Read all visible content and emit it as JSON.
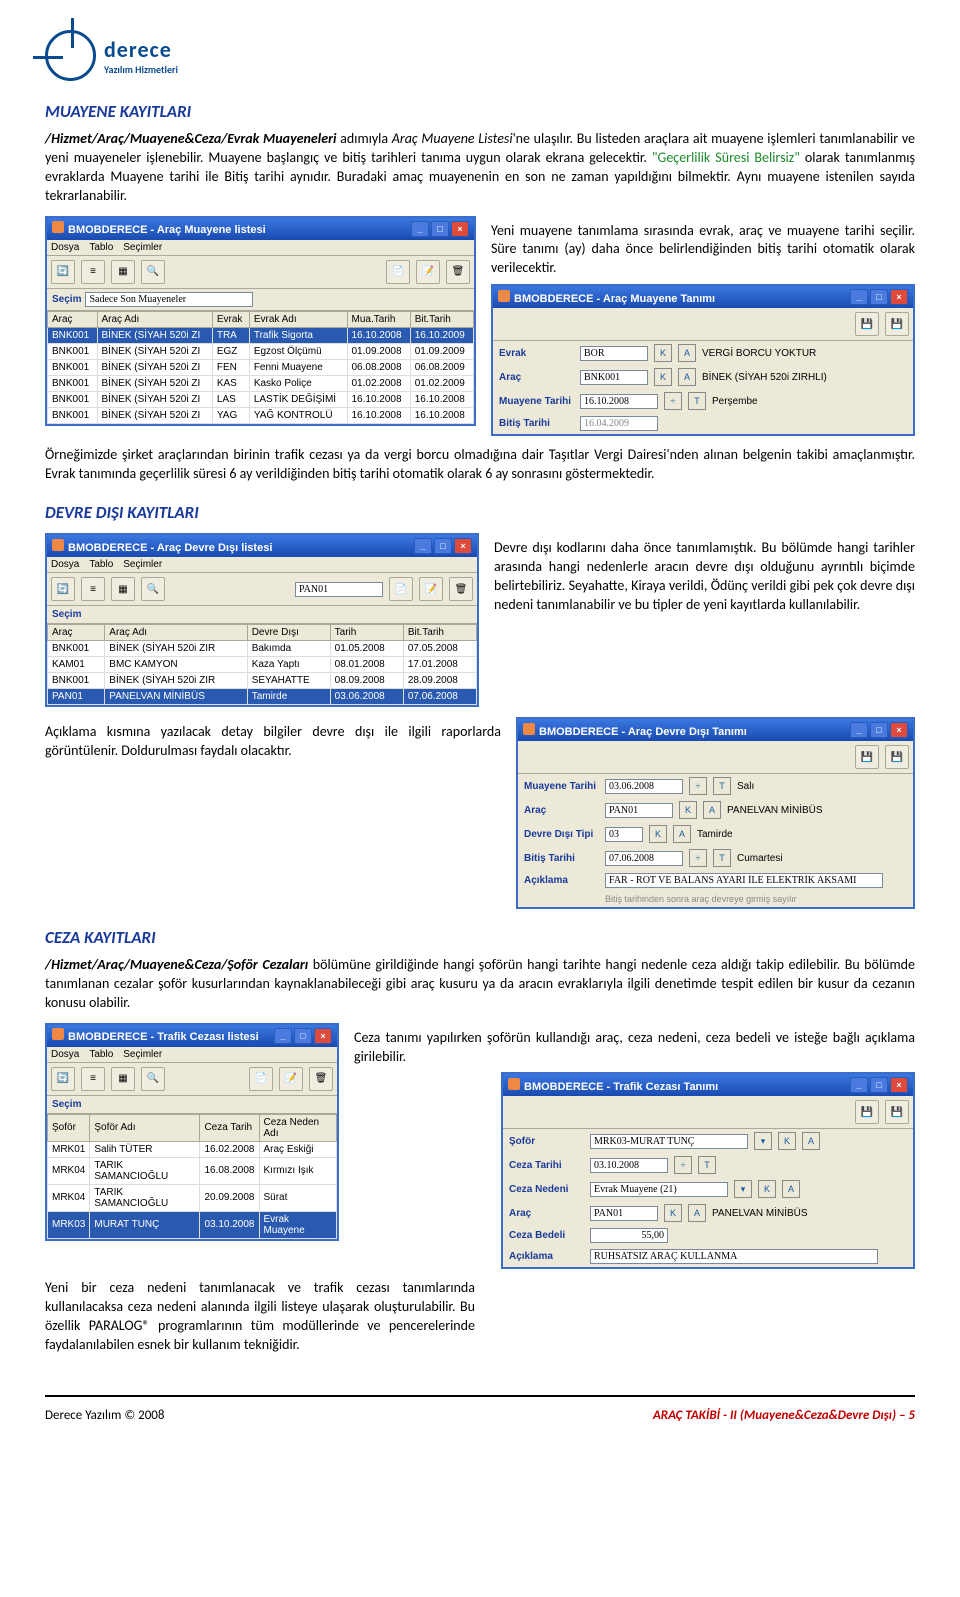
{
  "logo": {
    "t1": "derece",
    "t2": "Yazılım Hizmetleri"
  },
  "h1": "MUAYENE KAYITLARI",
  "p1a": "/Hizmet/Araç/Muayene&Ceza/Evrak Muayeneleri",
  "p1b": " adımıyla ",
  "p1c": "Araç Muayene Listesi",
  "p1d": "'ne ulaşılır. Bu listeden araçlara ait muayene işlemleri tanımlanabilir ve yeni muayeneler işlenebilir. Muayene başlangıç ve bitiş tarihleri tanıma uygun olarak ekrana gelecektir. ",
  "p1e": "\"Geçerlilik Süresi Belirsiz\"",
  "p1f": " olarak tanımlanmış evraklarda Muayene tarihi ile Bitiş tarihi aynıdır. Buradaki amaç muayenenin en son ne zaman yapıldığını bilmektir. Aynı muayene istenilen sayıda tekrarlanabilir.",
  "p2": "Yeni muayene tanımlama sırasında evrak, araç ve muayene tarihi seçilir. Süre tanımı (ay) daha önce belirlendiğinden bitiş tarihi otomatik olarak verilecektir.",
  "p3": "Örneğimizde şirket araçlarından birinin trafik cezası ya da vergi borcu olmadığına dair Taşıtlar Vergi Dairesi'nden alınan belgenin takibi amaçlanmıştır. Evrak tanımında geçerlilik süresi 6 ay verildiğinden bitiş tarihi otomatik olarak 6 ay sonrasını göstermektedir.",
  "h2": "DEVRE DIŞI KAYITLARI",
  "p4": "Devre dışı kodlarını daha önce tanımlamıştık. Bu bölümde hangi tarihler arasında hangi nedenlerle aracın devre dışı olduğunu ayrıntılı biçimde belirtebiliriz. Seyahatte, Kiraya verildi, Ödünç verildi gibi pek çok devre dışı nedeni tanımlanabilir ve bu tipler de yeni kayıtlarda kullanılabilir.",
  "p5": "Açıklama kısmına yazılacak detay bilgiler devre dışı ile ilgili raporlarda görüntülenir. Doldurulması faydalı olacaktır.",
  "h3": "CEZA KAYITLARI",
  "p6a": "/Hizmet/Araç/Muayene&Ceza/Şoför Cezaları",
  "p6b": " bölümüne girildiğinde hangi şoförün hangi tarihte hangi nedenle ceza aldığı takip edilebilir. Bu bölümde tanımlanan cezalar şoför kusurlarından kaynaklanabileceği gibi araç kusuru ya da aracın evraklarıyla ilgili denetimde tespit edilen bir kusur da cezanın konusu olabilir.",
  "p7": "Ceza tanımı yapılırken şoförün kullandığı araç, ceza nedeni, ceza bedeli ve isteğe bağlı açıklama girilebilir.",
  "p8": "Yeni bir ceza nedeni tanımlanacak ve trafik cezası tanımlarında kullanılacaksa ceza nedeni alanında ilgili listeye ulaşarak oluşturulabilir. Bu özellik PARALOG® programlarının tüm modüllerinde ve pencerelerinde faydalanılabilen esnek bir kullanım tekniğidir.",
  "footL": "Derece Yazılım © 2008",
  "footR": "ARAÇ TAKİBİ - II (Muayene&Ceza&Devre Dışı) – 5",
  "win1": {
    "title": "BMOBDERECE - Araç Muayene listesi",
    "menu": [
      "Dosya",
      "Tablo",
      "Seçimler"
    ],
    "secimLbl": "Seçim",
    "secimVal": "Sadece Son Muayeneler",
    "cols": [
      "Araç",
      "Araç Adı",
      "Evrak",
      "Evrak Adı",
      "Mua.Tarih",
      "Bit.Tarih"
    ],
    "rows": [
      [
        "BNK001",
        "BİNEK (SİYAH 520i ZI",
        "TRA",
        "Trafik Sigorta",
        "16.10.2008",
        "16.10.2009"
      ],
      [
        "BNK001",
        "BİNEK (SİYAH 520i ZI",
        "EGZ",
        "Egzost Ölçümü",
        "01.09.2008",
        "01.09.2009"
      ],
      [
        "BNK001",
        "BİNEK (SİYAH 520i ZI",
        "FEN",
        "Fenni Muayene",
        "06.08.2008",
        "06.08.2009"
      ],
      [
        "BNK001",
        "BİNEK (SİYAH 520i ZI",
        "KAS",
        "Kasko Poliçe",
        "01.02.2008",
        "01.02.2009"
      ],
      [
        "BNK001",
        "BİNEK (SİYAH 520i ZI",
        "LAS",
        "LASTİK DEĞİŞİMİ",
        "16.10.2008",
        "16.10.2008"
      ],
      [
        "BNK001",
        "BİNEK (SİYAH 520i ZI",
        "YAG",
        "YAĞ KONTROLÜ",
        "16.10.2008",
        "16.10.2008"
      ]
    ]
  },
  "win2": {
    "title": "BMOBDERECE - Araç Muayene Tanımı",
    "f": {
      "evrak": "Evrak",
      "evrakV": "BOR",
      "evrakT": "VERGİ BORCU YOKTUR",
      "arac": "Araç",
      "aracV": "BNK001",
      "aracT": "BİNEK (SİYAH 520i ZIRHLI)",
      "mt": "Muayene Tarihi",
      "mtV": "16.10.2008",
      "mtD": "Perşembe",
      "bt": "Bitiş Tarihi",
      "btV": "16.04.2009"
    }
  },
  "win3": {
    "title": "BMOBDERECE - Araç Devre Dışı listesi",
    "menu": [
      "Dosya",
      "Tablo",
      "Seçimler"
    ],
    "secimLbl": "Seçim",
    "filterVal": "PAN01",
    "cols": [
      "Araç",
      "Araç Adı",
      "Devre Dışı",
      "Tarih",
      "Bit.Tarih"
    ],
    "rows": [
      [
        "BNK001",
        "BİNEK (SİYAH 520i ZIR",
        "Bakımda",
        "01.05.2008",
        "07.05.2008"
      ],
      [
        "KAM01",
        "BMC KAMYON",
        "Kaza Yaptı",
        "08.01.2008",
        "17.01.2008"
      ],
      [
        "BNK001",
        "BİNEK (SİYAH 520i ZIR",
        "SEYAHATTE",
        "08.09.2008",
        "28.09.2008"
      ],
      [
        "PAN01",
        "PANELVAN MİNİBÜS",
        "Tamirde",
        "03.06.2008",
        "07.06.2008"
      ]
    ]
  },
  "win4": {
    "title": "BMOBDERECE - Araç Devre Dışı Tanımı",
    "f": {
      "mt": "Muayene Tarihi",
      "mtV": "03.06.2008",
      "mtD": "Salı",
      "ar": "Araç",
      "arV": "PAN01",
      "arT": "PANELVAN MİNİBÜS",
      "dd": "Devre Dışı Tipi",
      "ddV": "03",
      "ddT": "Tamirde",
      "bt": "Bitiş Tarihi",
      "btV": "07.06.2008",
      "btD": "Cumartesi",
      "ac": "Açıklama",
      "acV": "FAR - ROT VE BALANS AYARI İLE ELEKTRİK AKSAMI",
      "note": "Bitiş tarihinden sonra araç devreye girmiş sayılır"
    }
  },
  "win5": {
    "title": "BMOBDERECE - Trafik Cezası listesi",
    "menu": [
      "Dosya",
      "Tablo",
      "Seçimler"
    ],
    "secimLbl": "Seçim",
    "cols": [
      "Şoför",
      "Şoför Adı",
      "Ceza Tarih",
      "Ceza Neden Adı"
    ],
    "rows": [
      [
        "MRK01",
        "Salih TÜTER",
        "16.02.2008",
        "Araç Eskiği"
      ],
      [
        "MRK04",
        "TARIK SAMANCIOĞLU",
        "16.08.2008",
        "Kırmızı Işık"
      ],
      [
        "MRK04",
        "TARIK SAMANCIOĞLU",
        "20.09.2008",
        "Sürat"
      ],
      [
        "MRK03",
        "MURAT TUNÇ",
        "03.10.2008",
        "Evrak Muayene"
      ]
    ]
  },
  "win6": {
    "title": "BMOBDERECE - Trafik Cezası Tanımı",
    "f": {
      "so": "Şoför",
      "soV": "MRK03-MURAT TUNÇ",
      "ct": "Ceza Tarihi",
      "ctV": "03.10.2008",
      "cn": "Ceza Nedeni",
      "cnV": "Evrak Muayene (21)",
      "ar": "Araç",
      "arV": "PAN01",
      "arT": "PANELVAN MİNİBÜS",
      "cb": "Ceza Bedeli",
      "cbV": "55,00",
      "ac": "Açıklama",
      "acV": "RUHSATSIZ ARAÇ KULLANMA"
    }
  }
}
